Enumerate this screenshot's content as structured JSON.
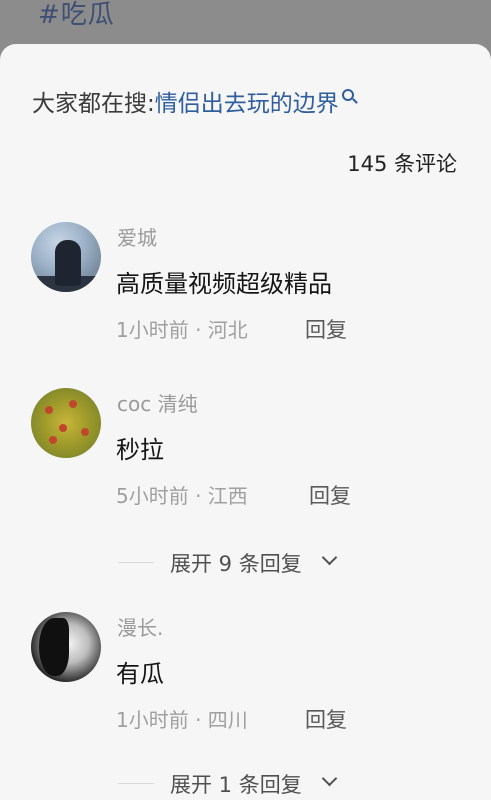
{
  "header": {
    "hashtag": "#吃瓜"
  },
  "search_hint": {
    "prefix": "大家都在搜:",
    "query": "情侣出去玩的边界"
  },
  "comments_header": {
    "count_text": "145 条评论"
  },
  "comments": [
    {
      "username": "爱城",
      "content": "高质量视频超级精品",
      "meta": "1小时前 · 河北",
      "reply_label": "回复"
    },
    {
      "username": "coc 清纯",
      "content": "秒拉",
      "meta": "5小时前 · 江西",
      "reply_label": "回复",
      "expand_label": "展开 9 条回复"
    },
    {
      "username": "漫长.",
      "content": "有瓜",
      "meta": "1小时前 · 四川",
      "reply_label": "回复",
      "expand_label": "展开 1 条回复"
    }
  ],
  "colors": {
    "link": "#2f5e9e",
    "sheet_bg": "#f6f6f6",
    "overlay": "#8c8c8c"
  }
}
